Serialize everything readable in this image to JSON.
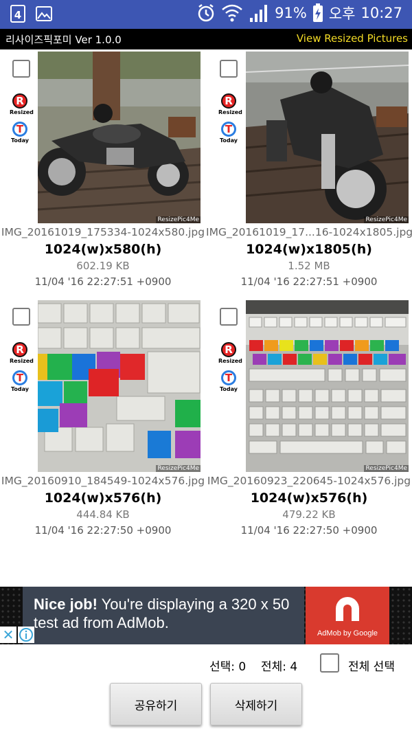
{
  "status_bar": {
    "battery": "91%",
    "ampm": "오후",
    "time": "10:27",
    "icons": [
      "app-4-icon",
      "gallery-icon",
      "alarm-icon",
      "wifi-icon",
      "signal-icon",
      "battery-charging-icon"
    ]
  },
  "app": {
    "title": "리사이즈픽포미 Ver 1.0.0",
    "view_link": "View Resized Pictures"
  },
  "badges": {
    "resized": "Resized",
    "today": "Today",
    "r_letter": "R",
    "t_letter": "T"
  },
  "watermark": "ResizePic4Me",
  "images": [
    {
      "filename": "IMG_20161019_175334-1024x580.jpg",
      "dims": "1024(w)x580(h)",
      "size": "602.19 KB",
      "date": "11/04 '16 22:27:51 +0900"
    },
    {
      "filename": "IMG_20161019_17...16-1024x1805.jpg",
      "dims": "1024(w)x1805(h)",
      "size": "1.52 MB",
      "date": "11/04 '16 22:27:51 +0900"
    },
    {
      "filename": "IMG_20160910_184549-1024x576.jpg",
      "dims": "1024(w)x576(h)",
      "size": "444.84 KB",
      "date": "11/04 '16 22:27:50 +0900"
    },
    {
      "filename": "IMG_20160923_220645-1024x576.jpg",
      "dims": "1024(w)x576(h)",
      "size": "479.22 KB",
      "date": "11/04 '16 22:27:50 +0900"
    }
  ],
  "ad": {
    "bold": "Nice job!",
    "text": " You're displaying a 320 x 50 test ad from AdMob.",
    "brand": "AdMob by Google"
  },
  "bottom": {
    "selected_label": "선택: 0",
    "total_label": "전체: 4",
    "select_all": "전체 선택",
    "share": "공유하기",
    "delete": "삭제하기"
  }
}
